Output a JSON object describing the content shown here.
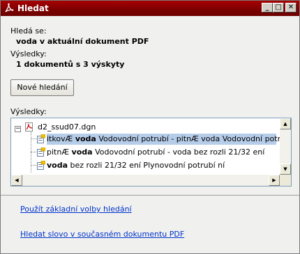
{
  "window": {
    "title": "Hledat",
    "minimize_label": "_",
    "maximize_label": "□",
    "close_label": "✕"
  },
  "search": {
    "scope_label": "Hledá se:",
    "scope_value": "voda v aktuální dokument PDF",
    "results_label": "Výsledky:",
    "results_summary": "1 dokumentů s 3 výskyty",
    "new_search_button": "Nové hledání"
  },
  "results_tree": {
    "label": "Výsledky:",
    "expander": "−",
    "document": "d2_ssud07.dgn",
    "items": [
      {
        "before": "itkovÆ ",
        "match": "voda",
        "after": " Vodovodní potrubí - pitnÆ voda Vodovodní potrubí -",
        "selected": true
      },
      {
        "before": "pitnÆ ",
        "match": "voda",
        "after": " Vodovodní potrubí - voda bez rozli 21/32 ení",
        "selected": false
      },
      {
        "before": " ",
        "match": "voda",
        "after": " bez rozli 21/32 ení Plynovodní potrubí ní",
        "selected": false
      }
    ]
  },
  "links": {
    "basic_options": "Použít základní volby hledání",
    "search_word": "Hledat slovo v současném dokumentu PDF"
  }
}
